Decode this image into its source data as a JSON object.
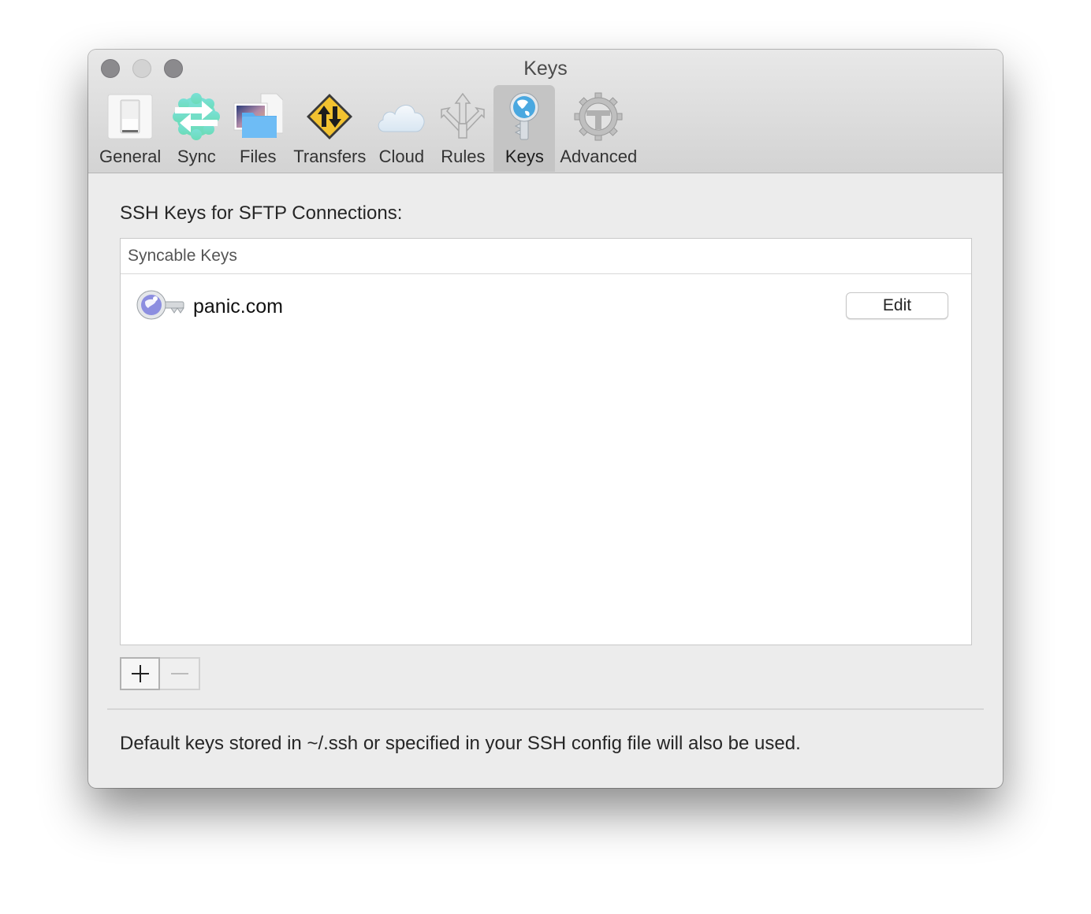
{
  "window": {
    "title": "Keys",
    "controls": [
      "close",
      "minimize",
      "zoom"
    ]
  },
  "toolbar": {
    "items": [
      {
        "label": "General",
        "icon": "light-switch-icon",
        "active": false
      },
      {
        "label": "Sync",
        "icon": "sync-arrows-icon",
        "active": false
      },
      {
        "label": "Files",
        "icon": "files-folder-icon",
        "active": false
      },
      {
        "label": "Transfers",
        "icon": "traffic-sign-arrows-icon",
        "active": false
      },
      {
        "label": "Cloud",
        "icon": "cloud-icon",
        "active": false
      },
      {
        "label": "Rules",
        "icon": "branching-arrows-icon",
        "active": false
      },
      {
        "label": "Keys",
        "icon": "globe-key-icon",
        "active": true
      },
      {
        "label": "Advanced",
        "icon": "gear-icon",
        "active": false
      }
    ]
  },
  "main": {
    "section_title": "SSH Keys for SFTP Connections:",
    "table": {
      "header": "Syncable Keys",
      "rows": [
        {
          "name": "panic.com",
          "icon": "key-icon",
          "action_label": "Edit"
        }
      ]
    },
    "add_label": "+",
    "remove_label": "−",
    "footer_note": "Default keys stored in ~/.ssh or specified in your SSH config file will also be used."
  },
  "colors": {
    "active_tab_bg": "#c4c4c4",
    "window_bg": "#ececec",
    "sync_green": "#6fdcc8",
    "transfers_yellow": "#f2c230",
    "globe_blue": "#4aa8e0"
  }
}
